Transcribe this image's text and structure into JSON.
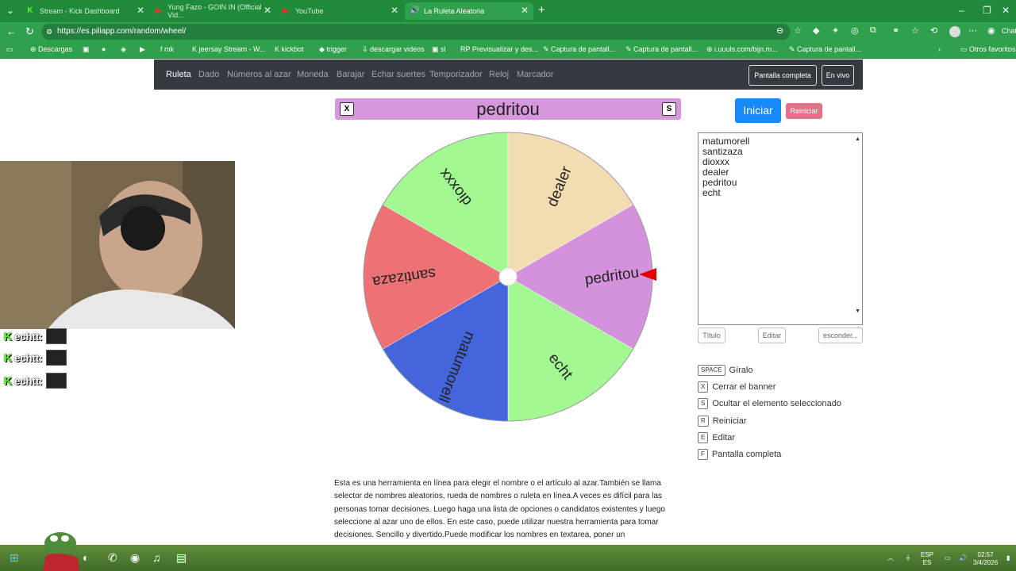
{
  "browser": {
    "tabs": [
      {
        "title": "Stream - Kick Dashboard",
        "icon": "kick-icon"
      },
      {
        "title": "Yung Fazo - GOIN IN (Official Vid...",
        "icon": "youtube-icon"
      },
      {
        "title": "YouTube",
        "icon": "youtube-icon"
      },
      {
        "title": "La Ruleta Aleatoria",
        "icon": "piliapp-icon",
        "active": true
      }
    ],
    "url": "https://es.piliapp.com/random/wheel/",
    "bookmarks": [
      "Descargas",
      "mk",
      "jeersay Stream - W...",
      "kickbot",
      "trigger",
      "descargar videos",
      "sl",
      "Previsualizar y des...",
      "Captura de pantall...",
      "Captura de pantall...",
      "i.uuuls.com/bijn.m...",
      "Captura de pantall..."
    ],
    "other_bookmarks": "Otros favoritos",
    "profile_label": "Chat"
  },
  "site": {
    "nav": [
      "Ruleta",
      "Dado",
      "Números al azar",
      "Moneda",
      "Barajar",
      "Echar suertes",
      "Temporizador",
      "Reloj",
      "Marcador"
    ],
    "fullscreen_btn": "Pantalla completa",
    "live_btn": "En vivo"
  },
  "banner": {
    "title": "pedritou",
    "close_key": "X",
    "hide_key": "S"
  },
  "wheel": {
    "segments": [
      {
        "label": "pedritou",
        "color": "#d592dc"
      },
      {
        "label": "echt",
        "color": "#a3f991"
      },
      {
        "label": "matumorell",
        "color": "#4565dc"
      },
      {
        "label": "santizaza",
        "color": "#ed7276"
      },
      {
        "label": "dioxxx",
        "color": "#a3f991"
      },
      {
        "label": "dealer",
        "color": "#f2dcb2"
      }
    ]
  },
  "controls": {
    "start": "Iniciar",
    "reset": "Reiniciar",
    "names": [
      "matumorell",
      "santizaza",
      "dioxxx",
      "dealer",
      "pedritou",
      "echt"
    ],
    "title_btn": "Título",
    "edit_btn": "Editar",
    "hide_btn": "esconder..."
  },
  "shortcuts": [
    {
      "key": "SPACE",
      "label": "Gíralo"
    },
    {
      "key": "X",
      "label": "Cerrar el banner"
    },
    {
      "key": "S",
      "label": "Ocultar el elemento seleccionado"
    },
    {
      "key": "R",
      "label": "Reiniciar"
    },
    {
      "key": "E",
      "label": "Editar"
    },
    {
      "key": "F",
      "label": "Pantalla completa"
    }
  ],
  "description": "Esta es una herramienta en línea para elegir el nombre o el artículo al azar.También se llama selector de nombres aleatorios, rueda de nombres o ruleta en línea.A veces es difícil para las personas tomar decisiones. Luego haga una lista de opciones o candidatos existentes y luego seleccione al azar uno de ellos. En este caso, puede utilizar nuestra herramienta para tomar decisiones. Sencillo y divertido.Puede modificar los nombres en textarea, poner un",
  "stream_chat": [
    {
      "user": "echtt:"
    },
    {
      "user": "echtt:"
    },
    {
      "user": "echtt:"
    }
  ],
  "taskbar": {
    "lang": "ESP",
    "lang2": "ES",
    "time": "02:57",
    "date": "3/4/2026"
  }
}
